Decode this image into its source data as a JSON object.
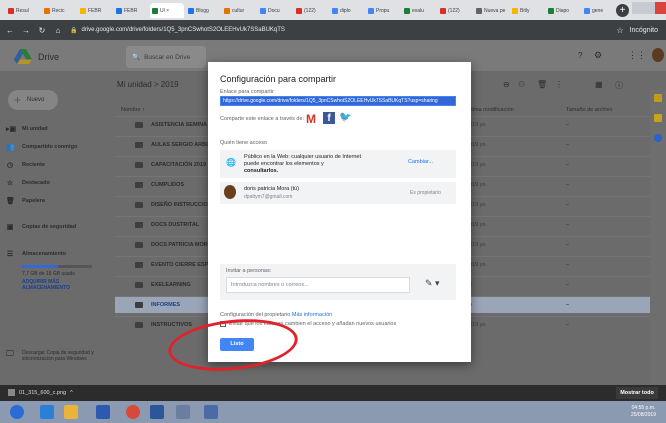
{
  "browser": {
    "tabs": [
      "Resul",
      "Recic",
      "FEBR",
      "FEBR",
      "Ul ×",
      "Blogg",
      "cultur",
      "Docu",
      "(122)",
      "diplo",
      "Propu",
      "evalu",
      "(122)",
      "Nueva pe",
      "Bitly",
      "Diapo",
      "gene"
    ],
    "url": "drive.google.com/drive/folders/1Q5_3pnCSwhotS2OLEEHvUk7SSaBUKqTS",
    "incognito": "Incógnito"
  },
  "drive": {
    "app_name": "Drive",
    "search_placeholder": "Buscar en Drive",
    "new_button": "Nuevo",
    "sidebar": [
      "Mi unidad",
      "Compartido conmigo",
      "Reciente",
      "Destacado",
      "Papelera",
      "Copias de seguridad",
      "Almacenamiento"
    ],
    "storage_used": "7,7 GB de 15 GB usado",
    "buy_storage": "ADQUIRIR MÁS ALMACENAMIENTO",
    "backup_promo": "Descargar Copia de seguridad y sincronización para Windows",
    "breadcrumb": "Mi unidad  >  2019",
    "columns": {
      "name": "Nombre ↑",
      "modified": "Última modificación",
      "size": "Tamaño de archivo"
    },
    "rows": [
      {
        "name": "ASISTENCIA SEMINA",
        "date": "2019 yo",
        "size": "–"
      },
      {
        "name": "AULAS SERGIO ARBOL",
        "date": "2019 yo",
        "size": "–"
      },
      {
        "name": "CAPACITACIÓN 2019",
        "date": "2019 yo",
        "size": "–"
      },
      {
        "name": "CUMPLIDOS",
        "date": "2019 yo",
        "size": "–"
      },
      {
        "name": "DISEÑO INSTRUCCIO",
        "date": "2019 yo",
        "size": "–"
      },
      {
        "name": "DOCS DUSTRITAL",
        "date": "2019 yo",
        "size": "–"
      },
      {
        "name": "DOCS PATRICIA MOR",
        "date": "2019 yo",
        "size": "–"
      },
      {
        "name": "EVENTO CIERRE ESPE",
        "date": "2019 yo",
        "size": "–"
      },
      {
        "name": "EXELEARNING",
        "date": "yo",
        "size": "–"
      },
      {
        "name": "INFORMES",
        "date": "yo",
        "size": "–"
      },
      {
        "name": "INSTRUCTIVOS",
        "date": "2019 yo",
        "size": "–"
      }
    ]
  },
  "dialog": {
    "title": "Configuración para compartir",
    "link_label": "Enlace para compartir",
    "link": "https://drive.google.com/drive/folders/1Q5_3pnCSwhotS2OLEEHvUk7SSaBUKqTS?usp=sharing",
    "share_via": "Comparte este enlace a través de:",
    "who_access": "Quién tiene acceso",
    "access_public": "Público en la Web: cualquier usuario de Internet puede encontrar los elementos y",
    "access_role": "consultarlos.",
    "change": "Cambiar...",
    "owner_name": "doris patricia Mora (tú)",
    "owner_email": "dpattym7@gmail.com",
    "owner_role": "Es propietario",
    "invite_label": "Invitar a personas:",
    "invite_placeholder": "Introduzca nombres o correos...",
    "owner_settings": "Configuración del propietario",
    "more_info": "Más información",
    "checkbox_text": "Evitar que los editores cambien el acceso y añadan nuevos usuarios",
    "done": "Listo"
  },
  "download": {
    "file": "01_315_600_c.png",
    "show_all": "Mostrar todo"
  },
  "taskbar": {
    "time": "04:55 p.m.",
    "date": "25/08/2019"
  },
  "colors": {
    "accent": "#4285f4",
    "highlight": "#e0222a"
  }
}
